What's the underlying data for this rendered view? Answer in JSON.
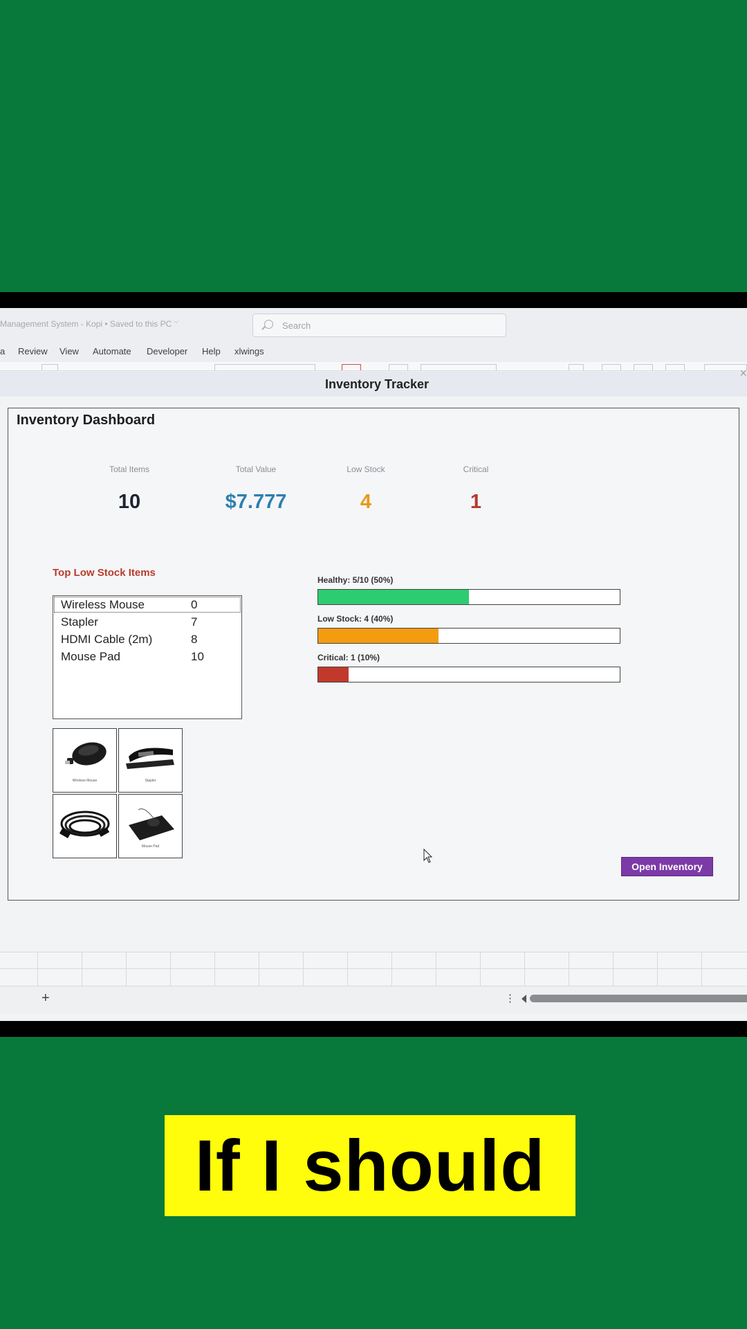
{
  "window": {
    "doc_title": "Management System - Kopi • Saved to this PC",
    "search_placeholder": "Search"
  },
  "menu": [
    "a",
    "Review",
    "View",
    "Automate",
    "Developer",
    "Help",
    "xlwings"
  ],
  "dialog": {
    "title": "Inventory Tracker",
    "close": "×"
  },
  "dashboard": {
    "title": "Inventory Dashboard",
    "kpis": [
      {
        "label": "Total Items",
        "value": "10",
        "color": "#1f2330"
      },
      {
        "label": "Total Value",
        "value": "$7.777",
        "color": "#2e7fb0"
      },
      {
        "label": "Low Stock",
        "value": "4",
        "color": "#e79a1b"
      },
      {
        "label": "Critical",
        "value": "1",
        "color": "#b23a2c"
      }
    ],
    "low_stock_title": "Top Low Stock Items",
    "low_stock_items": [
      {
        "name": "Wireless Mouse",
        "qty": "0"
      },
      {
        "name": "Stapler",
        "qty": "7"
      },
      {
        "name": "HDMI Cable (2m)",
        "qty": "8"
      },
      {
        "name": "Mouse Pad",
        "qty": "10"
      }
    ],
    "thumbnails": [
      {
        "icon": "wireless-mouse-image",
        "caption": "Wireless Mouse"
      },
      {
        "icon": "stapler-image",
        "caption": "Stapler"
      },
      {
        "icon": "hdmi-cable-image",
        "caption": ""
      },
      {
        "icon": "mouse-pad-image",
        "caption": "Mouse Pad"
      }
    ],
    "bars": [
      {
        "label": "Healthy: 5/10 (50%)",
        "fraction": 0.5,
        "color": "#2ecc71"
      },
      {
        "label": "Low Stock: 4 (40%)",
        "fraction": 0.4,
        "color": "#f39c12"
      },
      {
        "label": "Critical: 1 (10%)",
        "fraction": 0.1,
        "color": "#c0392b"
      }
    ],
    "open_button": "Open Inventory"
  },
  "statusbar": {
    "add_sheet": "+",
    "more": "⋮"
  },
  "caption": "If I should"
}
